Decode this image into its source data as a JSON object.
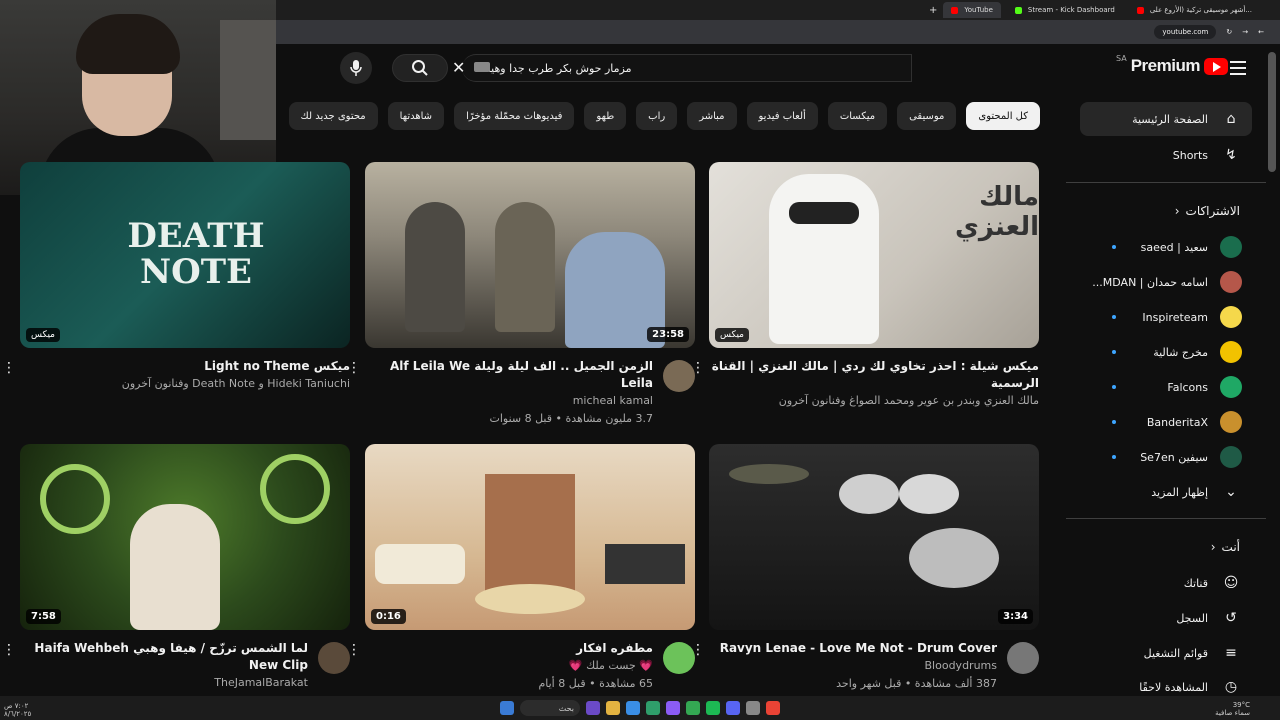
{
  "browser": {
    "tabs": [
      {
        "title": "YouTube",
        "active": true,
        "color": "#ff0000"
      },
      {
        "title": "Stream - Kick Dashboard",
        "active": false,
        "color": "#53fc18"
      },
      {
        "title": "أشهر موسيقى تركية (الأروع على...",
        "active": false,
        "color": "#ff0000"
      }
    ],
    "new_tab": "+",
    "url": "youtube.com"
  },
  "header": {
    "logo_word": "Premium",
    "region": "SA",
    "search_query": "مزمار حوش بكر طرب جدا وهيامه"
  },
  "chips": [
    "كل المحتوى",
    "موسيقى",
    "ميكسات",
    "ألعاب فيديو",
    "مباشر",
    "راب",
    "طهو",
    "فيديوهات محمّلة مؤخرًا",
    "شاهدتها",
    "محتوى جديد لك"
  ],
  "sidebar": {
    "main": [
      {
        "label": "الصفحة الرئيسية",
        "icon": "home-icon",
        "glyph": "⌂"
      },
      {
        "label": "Shorts",
        "icon": "shorts-icon",
        "glyph": "↯"
      }
    ],
    "subs_header": "الاشتراكات",
    "subs": [
      {
        "label": "سعيد | saeed",
        "color": "#1a6d4d"
      },
      {
        "label": "اسامه حمدان | MDAN...",
        "color": "#b5574a"
      },
      {
        "label": "Inspireteam",
        "color": "#f5d84b"
      },
      {
        "label": "مخرج شالية",
        "color": "#f2c200"
      },
      {
        "label": "Falcons",
        "color": "#1fa865"
      },
      {
        "label": "BanderitaX",
        "color": "#c9902d"
      },
      {
        "label": "سيفين Se7en",
        "color": "#1f5a46"
      }
    ],
    "show_more": "إظهار المزيد",
    "you_header": "أنت",
    "you": [
      {
        "label": "قناتك",
        "icon": "channel-icon",
        "glyph": "☺"
      },
      {
        "label": "السجل",
        "icon": "history-icon",
        "glyph": "↺"
      },
      {
        "label": "قوائم التشغيل",
        "icon": "playlists-icon",
        "glyph": "≡"
      },
      {
        "label": "المشاهدة لاحقًا",
        "icon": "watch-later-icon",
        "glyph": "◷"
      }
    ]
  },
  "videos": [
    {
      "title": "ميكس شيلة : احذر تخاوي لك ردي | مالك العنزي | القناة الرسمية",
      "line1": "مالك العنزي وبندر بن عوير ومحمد الصواغ وفنانون آخرون",
      "line2": "",
      "badge": "ميكس",
      "duration": "",
      "avatar": "",
      "thumb": "t-grad1",
      "thumb_text": "مالك العنزي"
    },
    {
      "title": "الزمن الجميل .. الف ليلة وليلة Alf Leila We Leila",
      "line1": "micheal kamal",
      "line2": "3.7 مليون مشاهدة • قبل 8 سنوات",
      "badge": "",
      "duration": "23:58",
      "avatar": "#7a6a55",
      "thumb": "t-grad2",
      "thumb_text": ""
    },
    {
      "title": "ميكس Light no Theme",
      "line1": "Hideki Taniuchi و Death Note وفنانون آخرون",
      "line2": "",
      "badge": "ميكس",
      "duration": "",
      "avatar": "",
      "thumb": "t-grad3",
      "thumb_text": "DEATH NOTE"
    },
    {
      "title": "Ravyn Lenae - Love Me Not - Drum Cover",
      "line1": "Bloodydrums",
      "line2": "387 ألف مشاهدة • قبل شهر واحد",
      "badge": "",
      "duration": "3:34",
      "avatar": "#777777",
      "thumb": "t-grad4",
      "thumb_text": ""
    },
    {
      "title": "مطفره افكار",
      "line1": "💗 جست ملك 💗",
      "line2": "65 مشاهدة • قبل 8 أيام",
      "badge": "",
      "duration": "0:16",
      "avatar": "#6cc25a",
      "thumb": "t-grad5",
      "thumb_text": ""
    },
    {
      "title": "لما الشمس ترزّح / هيفا وهبي Haifa Wehbeh New Clip",
      "line1": "TheJamalBarakat",
      "line2": "",
      "badge": "",
      "duration": "7:58",
      "avatar": "#5a4a3a",
      "thumb": "t-grad6",
      "thumb_text": ""
    }
  ],
  "taskbar": {
    "search": "بحث",
    "temp": "39°C",
    "weather": "سماء صافية",
    "time": "٧:٠٢ ص",
    "date": "٨/٦/٢٠٢٥"
  }
}
